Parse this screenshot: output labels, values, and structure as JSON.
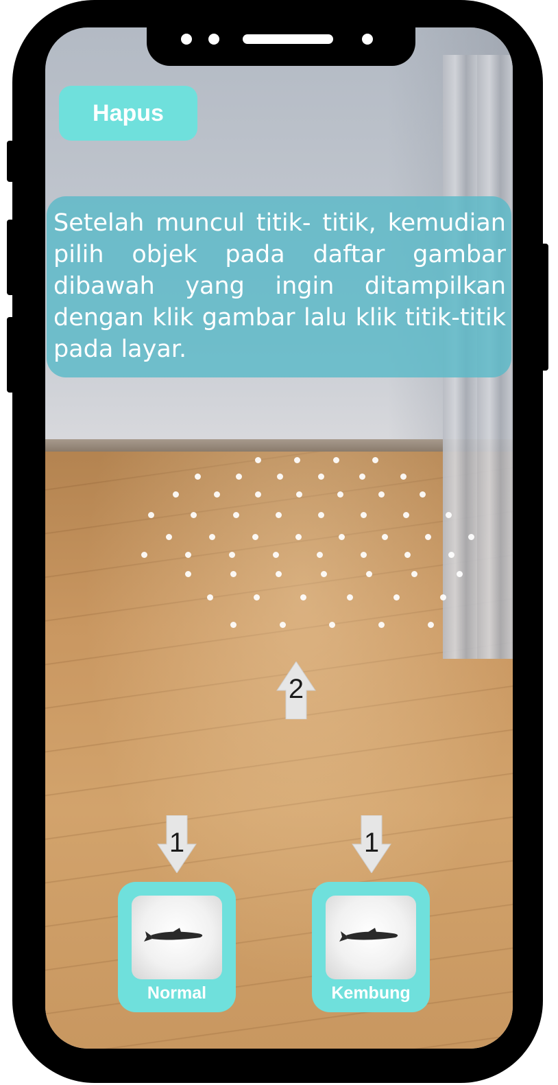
{
  "toolbar": {
    "hapus_label": "Hapus"
  },
  "instruction": {
    "text": "Setelah muncul titik- titik, kemudian pilih objek pada daftar gambar dibawah yang ingin ditampilkan dengan klik gambar lalu klik titik-titik pada layar."
  },
  "step_markers": {
    "step_left": "1",
    "step_right": "1",
    "step_up": "2"
  },
  "objects": [
    {
      "label": "Normal",
      "icon": "fish-icon"
    },
    {
      "label": "Kembung",
      "icon": "fish-icon"
    }
  ],
  "colors": {
    "accent": "#6fe0dc",
    "instruction_bg": "#5ab9c8",
    "phone_frame": "#000000"
  }
}
